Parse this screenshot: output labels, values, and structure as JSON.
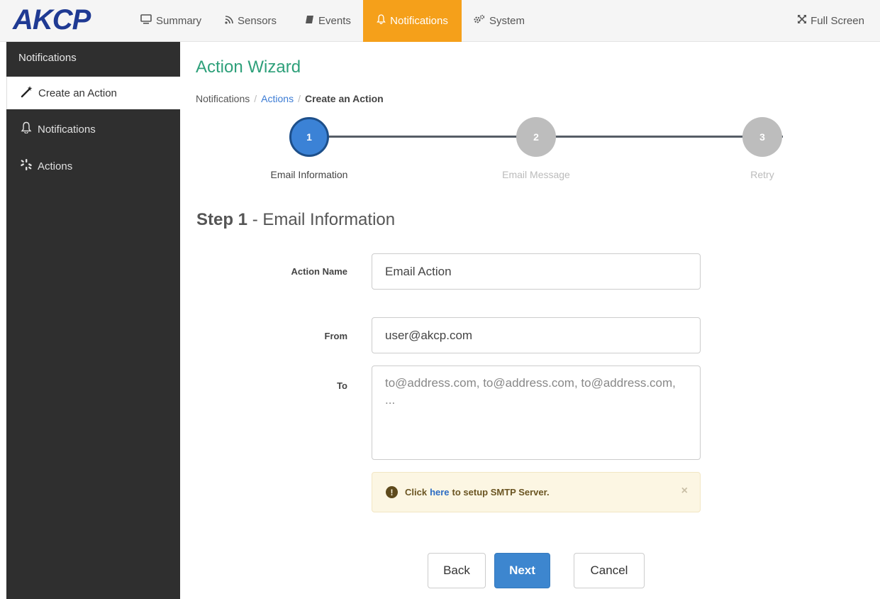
{
  "navbar": {
    "logo": "AKCP",
    "items": [
      {
        "label": "Summary",
        "icon": "monitor-icon"
      },
      {
        "label": "Sensors",
        "icon": "rss-icon"
      },
      {
        "label": "Events",
        "icon": "book-icon"
      },
      {
        "label": "Notifications",
        "icon": "bell-icon",
        "active": true
      },
      {
        "label": "System",
        "icon": "gears-icon"
      }
    ],
    "fullscreen_label": "Full Screen",
    "accent_color": "#f5a01a"
  },
  "sidebar": {
    "header": "Notifications",
    "items": [
      {
        "label": "Create an Action",
        "icon": "magic-wand-icon",
        "active": true
      },
      {
        "label": "Notifications",
        "icon": "bell-icon"
      },
      {
        "label": "Actions",
        "icon": "actions-icon"
      }
    ]
  },
  "main": {
    "title": "Action Wizard",
    "breadcrumb": {
      "root": "Notifications",
      "link": "Actions",
      "current": "Create an Action"
    },
    "steps": [
      {
        "number": "1",
        "label": "Email Information",
        "current": true
      },
      {
        "number": "2",
        "label": "Email Message"
      },
      {
        "number": "3",
        "label": "Retry"
      }
    ],
    "step_heading": {
      "bold": "Step 1",
      "rest": " - Email Information"
    },
    "form": {
      "action_name_label": "Action Name",
      "action_name_value": "Email Action",
      "from_label": "From",
      "from_value": "user@akcp.com",
      "to_label": "To",
      "to_placeholder": "to@address.com, to@address.com, to@address.com, ..."
    },
    "alert": {
      "prefix": "Click",
      "link": "here",
      "suffix": "to setup SMTP Server.",
      "close": "×"
    },
    "buttons": {
      "back": "Back",
      "next": "Next",
      "cancel": "Cancel"
    }
  }
}
